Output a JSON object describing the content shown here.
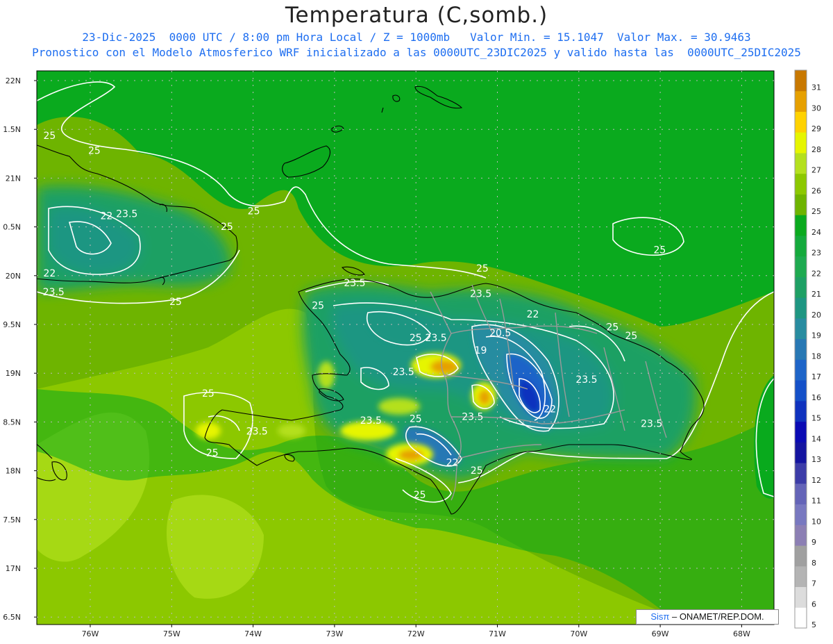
{
  "title": "Temperatura (C,somb.)",
  "subtitle_line1": "23-Dic-2025  0000 UTC / 8:00 pm Hora Local / Z = 1000mb   Valor Min. = 15.1047  Valor Max. = 30.9463",
  "subtitle_line2": "Pronostico con el Modelo Atmosferico WRF inicializado a las 0000UTC_23DIC2025 y valido hasta las  0000UTC_25DIC2025",
  "credit": {
    "brand": "Sisπ",
    "text": " – ONAMET/REP.DOM."
  },
  "lat_labels": [
    "22N",
    "1.5N",
    "21N",
    "0.5N",
    "20N",
    "9.5N",
    "19N",
    "8.5N",
    "18N",
    "7.5N",
    "17N",
    "6.5N"
  ],
  "lon_labels": [
    "76W",
    "75W",
    "74W",
    "73W",
    "72W",
    "71W",
    "70W",
    "69W",
    "68W"
  ],
  "colorbar": {
    "levels": [
      "5",
      "6",
      "7",
      "8",
      "9",
      "10",
      "11",
      "12",
      "13",
      "14",
      "15",
      "16",
      "17",
      "18",
      "19",
      "20",
      "21",
      "22",
      "23",
      "24",
      "25",
      "26",
      "27",
      "28",
      "29",
      "30",
      "31"
    ],
    "colors": [
      "#ffffff",
      "#dcdcdc",
      "#b4b4b4",
      "#a0a0a0",
      "#8c7fb4",
      "#7878c0",
      "#6464b8",
      "#3c3ca8",
      "#1414a0",
      "#0a0ab4",
      "#0f32be",
      "#1450c8",
      "#1e64c8",
      "#2878b4",
      "#288ca0",
      "#1e9682",
      "#1ea064",
      "#1eaa50",
      "#14aa3c",
      "#0aaa1e",
      "#6eb400",
      "#8cc800",
      "#b4e01e",
      "#e6f500",
      "#ffd200",
      "#e6a000",
      "#c87800"
    ]
  },
  "contour_labels": [
    {
      "text": "25",
      "lon": -76.5,
      "lat": 21.4
    },
    {
      "text": "25",
      "lon": -75.95,
      "lat": 21.25
    },
    {
      "text": "22",
      "lon": -75.8,
      "lat": 20.58
    },
    {
      "text": "23.5",
      "lon": -75.55,
      "lat": 20.6
    },
    {
      "text": "25",
      "lon": -74.32,
      "lat": 20.47
    },
    {
      "text": "25",
      "lon": -73.99,
      "lat": 20.63
    },
    {
      "text": "22",
      "lon": -76.5,
      "lat": 19.99
    },
    {
      "text": "23.5",
      "lon": -76.45,
      "lat": 19.8
    },
    {
      "text": "25",
      "lon": -74.95,
      "lat": 19.7
    },
    {
      "text": "25",
      "lon": -73.2,
      "lat": 19.66
    },
    {
      "text": "23.5",
      "lon": -72.75,
      "lat": 19.89
    },
    {
      "text": "25",
      "lon": -71.18,
      "lat": 20.04
    },
    {
      "text": "23.5",
      "lon": -71.2,
      "lat": 19.78
    },
    {
      "text": "22",
      "lon": -70.56,
      "lat": 19.57
    },
    {
      "text": "25",
      "lon": -69.58,
      "lat": 19.44
    },
    {
      "text": "25",
      "lon": -69.35,
      "lat": 19.35
    },
    {
      "text": "25",
      "lon": -69.0,
      "lat": 20.23
    },
    {
      "text": "20.5",
      "lon": -70.96,
      "lat": 19.38
    },
    {
      "text": "19",
      "lon": -71.2,
      "lat": 19.2
    },
    {
      "text": "25",
      "lon": -72.0,
      "lat": 19.33
    },
    {
      "text": "23.5",
      "lon": -71.75,
      "lat": 19.33
    },
    {
      "text": "23.5",
      "lon": -72.15,
      "lat": 18.98
    },
    {
      "text": "23.5",
      "lon": -69.9,
      "lat": 18.9
    },
    {
      "text": "25",
      "lon": -74.55,
      "lat": 18.76
    },
    {
      "text": "23.5",
      "lon": -73.95,
      "lat": 18.37
    },
    {
      "text": "25",
      "lon": -74.5,
      "lat": 18.15
    },
    {
      "text": "23.5",
      "lon": -72.55,
      "lat": 18.48
    },
    {
      "text": "25",
      "lon": -72.0,
      "lat": 18.5
    },
    {
      "text": "23.5",
      "lon": -71.3,
      "lat": 18.52
    },
    {
      "text": "22",
      "lon": -70.35,
      "lat": 18.6
    },
    {
      "text": "23.5",
      "lon": -69.1,
      "lat": 18.45
    },
    {
      "text": "22",
      "lon": -71.55,
      "lat": 18.05
    },
    {
      "text": "25",
      "lon": -71.25,
      "lat": 17.97
    },
    {
      "text": "25",
      "lon": -71.95,
      "lat": 17.72
    }
  ]
}
